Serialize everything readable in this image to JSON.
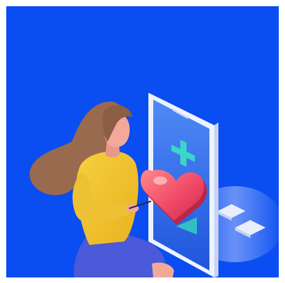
{
  "illustration": {
    "subject": "woman-with-phone-health-app",
    "icons": [
      "medical-cross-icon",
      "heart-icon"
    ],
    "colors": {
      "background": "#0a4df0",
      "phone_frame": "#eef2ff",
      "phone_screen": "#2f6ef0",
      "cross": "#3bd6c6",
      "heart": "#f0506a",
      "sweater": "#f2c230",
      "skirt": "#4a5ad8",
      "hair": "#9a6a4e",
      "skin": "#f2a99a"
    }
  }
}
